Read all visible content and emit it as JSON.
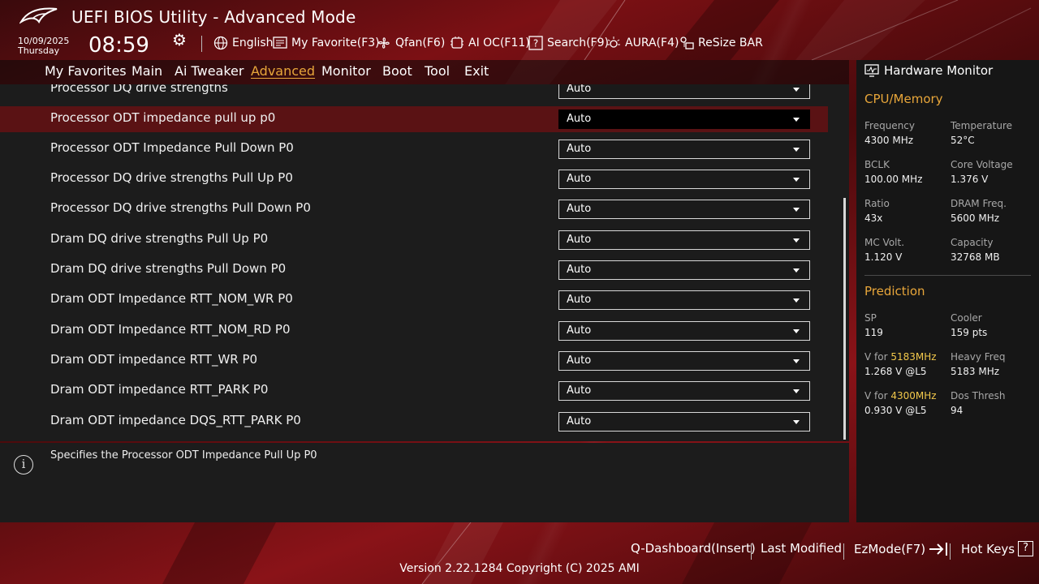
{
  "header": {
    "title": "UEFI BIOS Utility - Advanced Mode",
    "date": "10/09/2025",
    "day": "Thursday",
    "time": "08:59",
    "items": {
      "language": "English",
      "my_favorite": "My Favorite(F3)",
      "qfan": "Qfan(F6)",
      "ai_oc": "AI OC(F11)",
      "search": "Search(F9)",
      "aura": "AURA(F4)",
      "resize_bar": "ReSize BAR"
    }
  },
  "nav": {
    "tabs": [
      "My Favorites",
      "Main",
      "Ai Tweaker",
      "Advanced",
      "Monitor",
      "Boot",
      "Tool",
      "Exit"
    ],
    "active": "Advanced"
  },
  "settings": {
    "partial_row": {
      "label": "Processor DQ drive strengths",
      "value": "Auto"
    },
    "rows": [
      {
        "label": "Processor ODT impedance pull up p0",
        "value": "Auto",
        "selected": true
      },
      {
        "label": "Processor ODT Impedance Pull Down P0",
        "value": "Auto"
      },
      {
        "label": "Processor DQ drive strengths Pull Up P0",
        "value": "Auto"
      },
      {
        "label": "Processor DQ drive strengths Pull Down P0",
        "value": "Auto"
      },
      {
        "label": "Dram DQ drive strengths Pull Up P0",
        "value": "Auto"
      },
      {
        "label": "Dram DQ drive strengths Pull Down P0",
        "value": "Auto"
      },
      {
        "label": "Dram ODT Impedance RTT_NOM_WR P0",
        "value": "Auto"
      },
      {
        "label": "Dram ODT Impedance RTT_NOM_RD P0",
        "value": "Auto"
      },
      {
        "label": "Dram ODT impedance RTT_WR P0",
        "value": "Auto"
      },
      {
        "label": "Dram ODT impedance RTT_PARK P0",
        "value": "Auto"
      },
      {
        "label": "Dram ODT impedance DQS_RTT_PARK P0",
        "value": "Auto"
      }
    ]
  },
  "help": {
    "text": "Specifies the Processor ODT Impedance Pull Up P0"
  },
  "hardware_monitor": {
    "title": "Hardware Monitor",
    "cpu_memory": {
      "heading": "CPU/Memory",
      "frequency_label": "Frequency",
      "frequency": "4300 MHz",
      "temperature_label": "Temperature",
      "temperature": "52°C",
      "bclk_label": "BCLK",
      "bclk": "100.00 MHz",
      "core_voltage_label": "Core Voltage",
      "core_voltage": "1.376 V",
      "ratio_label": "Ratio",
      "ratio": "43x",
      "dram_freq_label": "DRAM Freq.",
      "dram_freq": "5600 MHz",
      "mc_volt_label": "MC Volt.",
      "mc_volt": "1.120 V",
      "capacity_label": "Capacity",
      "capacity": "32768 MB"
    },
    "prediction": {
      "heading": "Prediction",
      "sp_label": "SP",
      "sp": "119",
      "cooler_label": "Cooler",
      "cooler": "159 pts",
      "v_for_prefix": "V for",
      "v1_freq": "5183MHz",
      "v1": "1.268 V @L5",
      "heavy_freq_label": "Heavy Freq",
      "heavy_freq": "5183 MHz",
      "v2_freq": "4300MHz",
      "v2": "0.930 V @L5",
      "dos_thresh_label": "Dos Thresh",
      "dos_thresh": "94"
    }
  },
  "footer": {
    "q_dashboard": "Q-Dashboard(Insert)",
    "last_modified": "Last Modified",
    "ezmode": "EzMode(F7)",
    "hot_keys": "Hot Keys",
    "hot_keys_icon": "?",
    "version": "Version 2.22.1284 Copyright (C) 2025 AMI"
  },
  "colors": {
    "accent": "#e8a63a",
    "highlight": "#f2c84b",
    "selected_row": "#5a1214",
    "brand_red": "#8a1318"
  }
}
